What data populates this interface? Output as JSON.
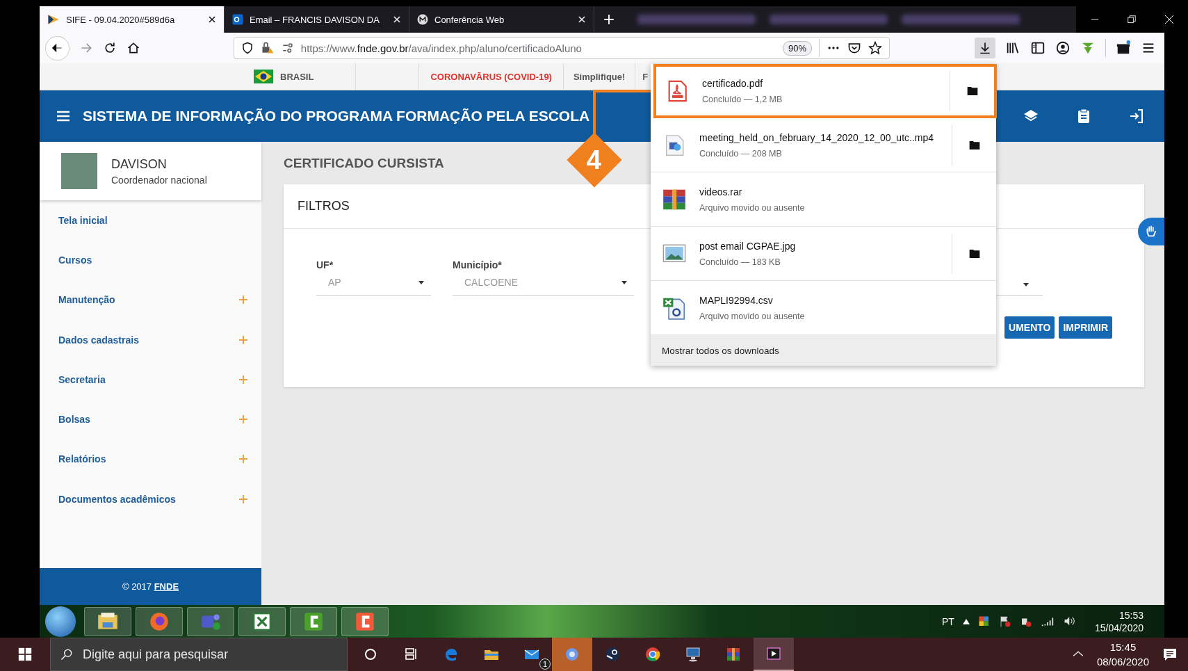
{
  "browser": {
    "tabs": [
      {
        "title": "SIFE - 09.04.2020#589d6a",
        "selected": true,
        "kind": "sife"
      },
      {
        "title": "Email – FRANCIS DAVISON DA",
        "selected": false,
        "kind": "outlook"
      },
      {
        "title": "Conferência Web",
        "selected": false,
        "kind": "conference"
      }
    ],
    "url": "https://www.**fnde.gov.br**/ava/index.php/aluno/certificadoAluno",
    "zoom": "90%"
  },
  "site_bar": {
    "country": "BRASIL",
    "links": [
      {
        "label": "CORONAVĀRUS (COVID-19)",
        "kind": "alert"
      },
      {
        "label": "Simplifique!",
        "kind": "normal"
      },
      {
        "label": "F",
        "kind": "normal"
      }
    ]
  },
  "header": {
    "title": "SISTEMA DE INFORMAÇÃO DO PROGRAMA FORMAÇÃO PELA ESCOLA"
  },
  "user": {
    "name": "DAVISON",
    "role": "Coordenador nacional"
  },
  "sidebar": {
    "items": [
      {
        "label": "Tela inicial",
        "expandable": false
      },
      {
        "label": "Cursos",
        "expandable": false
      },
      {
        "label": "Manutenção",
        "expandable": true
      },
      {
        "label": "Dados cadastrais",
        "expandable": true
      },
      {
        "label": "Secretaria",
        "expandable": true
      },
      {
        "label": "Bolsas",
        "expandable": true
      },
      {
        "label": "Relatórios",
        "expandable": true
      },
      {
        "label": "Documentos acadêmicos",
        "expandable": true
      }
    ],
    "footer": "© 2017 **FNDE**"
  },
  "page": {
    "title": "CERTIFICADO CURSISTA",
    "filter_title": "FILTROS",
    "fields": [
      {
        "label": "UF*",
        "value": "AP"
      },
      {
        "label": "Município*",
        "value": "CALCOENE"
      }
    ],
    "buttons": [
      "UMENTO",
      "IMPRIMIR"
    ]
  },
  "downloads": {
    "items": [
      {
        "name": "certificado.pdf",
        "status": "Concluído — 1,2 MB",
        "kind": "pdf",
        "folder_button": true,
        "highlighted": true
      },
      {
        "name": "meeting_held_on_february_14_2020_12_00_utc..mp4",
        "status": "Concluído — 208 MB",
        "kind": "video",
        "folder_button": true,
        "highlighted": false
      },
      {
        "name": "videos.rar",
        "status": "Arquivo movido ou ausente",
        "kind": "archive",
        "folder_button": false,
        "highlighted": false
      },
      {
        "name": "post email CGPAE.jpg",
        "status": "Concluído — 183 KB",
        "kind": "image",
        "folder_button": true,
        "highlighted": false
      },
      {
        "name": "MAPLI92994.csv",
        "status": "Arquivo movido ou ausente",
        "kind": "spreadsheet",
        "folder_button": false,
        "highlighted": false
      }
    ],
    "show_all": "Mostrar todos os downloads"
  },
  "annotation": {
    "step": "4"
  },
  "win7_taskbar": {
    "apps": [
      {
        "kind": "explorer"
      },
      {
        "kind": "firefox"
      },
      {
        "kind": "teams"
      },
      {
        "kind": "excel"
      },
      {
        "kind": "recorder"
      },
      {
        "kind": "editor"
      }
    ],
    "language": "PT",
    "time": "15:53",
    "date": "15/04/2020"
  },
  "win10_taskbar": {
    "search": {
      "placeholder": "Digite aqui para pesquisar"
    },
    "apps": [
      {
        "kind": "circle",
        "flashing": false,
        "running": false
      },
      {
        "kind": "taskview",
        "flashing": false,
        "running": false
      },
      {
        "kind": "edge",
        "flashing": false,
        "running": false
      },
      {
        "kind": "folder",
        "flashing": false,
        "running": false
      },
      {
        "kind": "mail",
        "flashing": false,
        "running": false,
        "badge": "1"
      },
      {
        "kind": "browser",
        "flashing": true,
        "running": false
      },
      {
        "kind": "steam",
        "flashing": false,
        "running": false
      },
      {
        "kind": "chrome",
        "flashing": false,
        "running": false
      },
      {
        "kind": "remote",
        "flashing": false,
        "running": false
      },
      {
        "kind": "archive",
        "flashing": false,
        "running": false
      },
      {
        "kind": "player",
        "flashing": false,
        "running": true
      }
    ],
    "time": "15:45",
    "date": "08/06/2020"
  }
}
